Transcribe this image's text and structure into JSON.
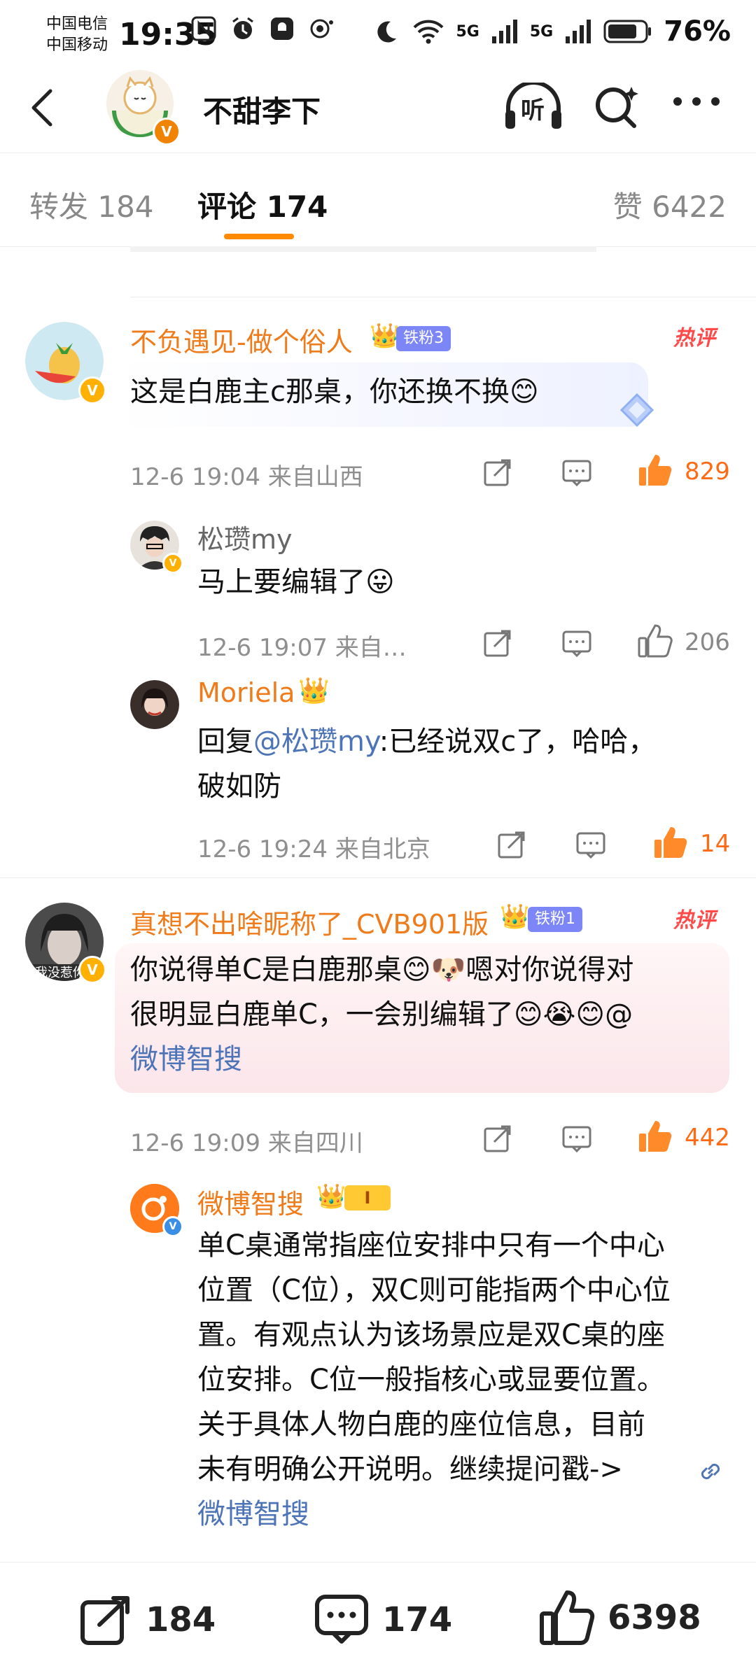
{
  "status_bar": {
    "carrier_1": "中国电信",
    "carrier_2": "中国移动",
    "time": "19:35",
    "battery": "76%",
    "signal_1": "5G",
    "signal_2": "5G"
  },
  "header": {
    "title": "不甜李下",
    "listen_label": "听"
  },
  "tabs": [
    {
      "label": "转发 184"
    },
    {
      "label": "评论 174"
    },
    {
      "label": "赞 6422"
    }
  ],
  "comments": [
    {
      "author": "不负遇见-做个俗人",
      "fan_badge": "铁粉3",
      "hot": "热评",
      "text": "这是白鹿主c那桌，你还换不换😊",
      "time": "12-6 19:04 来自山西",
      "likes": "829",
      "replies": [
        {
          "author": "松瓒my",
          "text": "马上要编辑了😛",
          "time": "12-6 19:07 来自…",
          "likes": "206"
        },
        {
          "author": "Moriela",
          "reply_prefix": "回复",
          "mention": "@松瓒my",
          "text": ":已经说双c了，哈哈，",
          "text_2": "破如防",
          "time": "12-6 19:24 来自北京",
          "likes": "14"
        }
      ]
    },
    {
      "author": "真想不出啥昵称了_CVB901版",
      "fan_badge": "铁粉1",
      "hot": "热评",
      "avatar_caption": "我没惹你",
      "text_1": "你说得单C是白鹿那桌😊🐶嗯对你说得对",
      "text_2": "很明显白鹿单C，一会别编辑了😊😭😊@",
      "mention": "微博智搜",
      "time": "12-6 19:09 来自四川",
      "likes": "442",
      "replies": [
        {
          "author": "微博智搜",
          "level": "I",
          "lines": [
            "单C桌通常指座位安排中只有一个中心",
            "位置（C位），双C则可能指两个中心位",
            "置。有观点认为该场景应是双C桌的座",
            "位安排。C位一般指核心或显要位置。",
            "关于具体人物白鹿的座位信息，目前",
            "未有明确公开说明。继续提问戳->"
          ],
          "link": "微博智搜"
        }
      ]
    }
  ],
  "bottom_bar": {
    "reposts": "184",
    "comments": "174",
    "likes": "6398"
  },
  "colors": {
    "accent": "#ff8a00",
    "name": "#ef7b1a",
    "liked": "#ff6a14",
    "link": "#4e74b8"
  }
}
